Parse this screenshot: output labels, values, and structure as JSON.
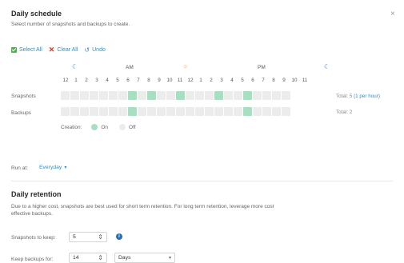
{
  "header": {
    "title": "Daily schedule",
    "subtitle": "Select number of snapshots and backups to create.",
    "close": "×"
  },
  "toolbar": {
    "select_all": "Select All",
    "clear_all": "Clear All",
    "undo": "Undo"
  },
  "timeline": {
    "am": "AM",
    "pm": "PM",
    "hours": [
      "12",
      "1",
      "2",
      "3",
      "4",
      "5",
      "6",
      "7",
      "8",
      "9",
      "10",
      "11",
      "12",
      "1",
      "2",
      "3",
      "4",
      "5",
      "6",
      "7",
      "8",
      "9",
      "10",
      "11"
    ],
    "snapshots": {
      "label": "Snapshots",
      "on": [
        7,
        9,
        12,
        16,
        19
      ],
      "total_prefix": "Total: 5",
      "total_link": "(1 per hour)"
    },
    "backups": {
      "label": "Backups",
      "on": [
        7,
        19
      ],
      "total": "Total: 2"
    },
    "legend": {
      "label": "Creation:",
      "on": "On",
      "off": "Off"
    }
  },
  "run_at": {
    "label": "Run at:",
    "value": "Everyday"
  },
  "retention": {
    "title": "Daily retention",
    "desc_line1": "Due to a higher cost, snapshots are best used for short term retention. For long term retention, leverage more cost",
    "desc_line2": "effective backups.",
    "snapshots_label": "Snapshots to keep:",
    "snapshots_value": "5",
    "backups_label": "Keep backups for:",
    "backups_value": "14",
    "backups_unit": "Days"
  }
}
